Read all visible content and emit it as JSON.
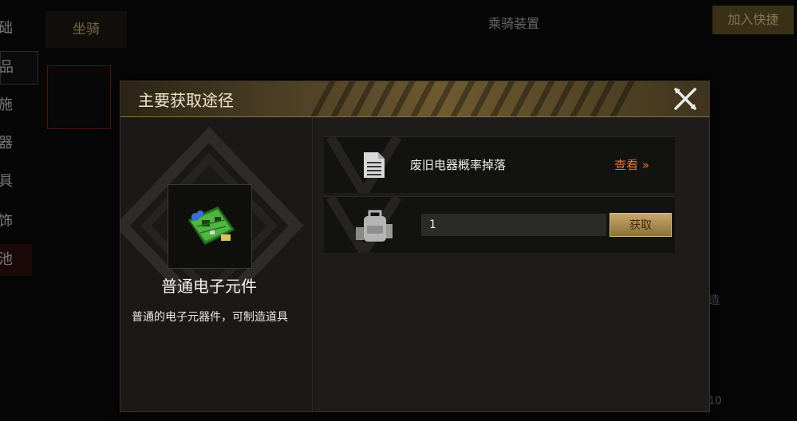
{
  "background": {
    "sidebar_items": [
      "础",
      "品",
      "施",
      "器",
      "具",
      "饰",
      "池"
    ],
    "mount_tab": "坐骑",
    "title": "乘骑装置",
    "add_shortcut_button": "加入快捷",
    "fragment_text_1": "造",
    "fragment_text_2": "10"
  },
  "modal": {
    "title": "主要获取途径",
    "item": {
      "name": "普通电子元件",
      "description": "普通的电子元器件，可制造道具"
    },
    "sources": {
      "drop_text": "废旧电器概率掉落",
      "view_label": "查看",
      "quantity_value": "1",
      "obtain_label": "获取"
    }
  },
  "colors": {
    "accent_gold": "#c8a76a",
    "link_orange": "#e8732a",
    "header_gold": "#6e5a30"
  },
  "icons": {
    "close": "close-icon",
    "document": "document-icon",
    "bag": "backpack-icon",
    "chevron": "double-chevron-right-icon",
    "item": "circuit-board-icon"
  }
}
